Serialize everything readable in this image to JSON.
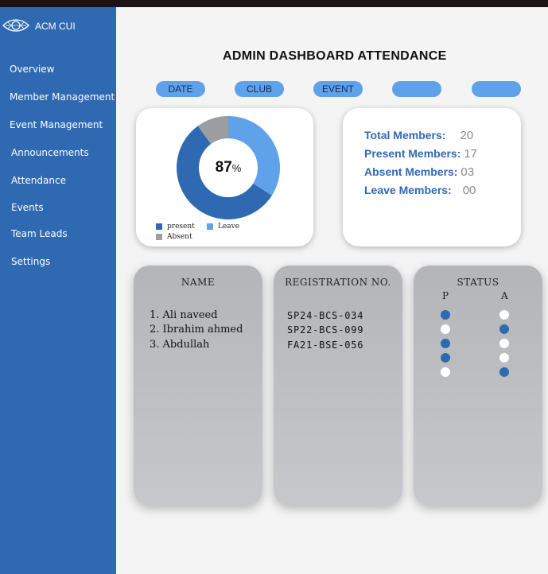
{
  "brand": {
    "name": "ACM CUI"
  },
  "nav": [
    {
      "label": "Overview"
    },
    {
      "label": "Member Management"
    },
    {
      "label": "Event Management"
    },
    {
      "label": "Announcements"
    },
    {
      "label": "Attendance"
    },
    {
      "label": "Events"
    },
    {
      "label": "Team Leads"
    },
    {
      "label": "Settings"
    }
  ],
  "page": {
    "title": "ADMIN DASHBOARD ATTENDANCE"
  },
  "filters": [
    {
      "label": "DATE"
    },
    {
      "label": "CLUB"
    },
    {
      "label": "EVENT"
    },
    {
      "label": ""
    },
    {
      "label": ""
    }
  ],
  "donut": {
    "center_value": "87",
    "center_unit": "%",
    "segments": [
      {
        "name": "present",
        "fraction": 0.56,
        "color": "#2f69b1"
      },
      {
        "name": "Leave",
        "fraction": 0.34,
        "color": "#5fa2ea"
      },
      {
        "name": "Absent",
        "fraction": 0.1,
        "color": "#9b9da1"
      }
    ],
    "legend": {
      "present": "present",
      "leave": "Leave",
      "absent": "Absent"
    }
  },
  "stats": [
    {
      "label": "Total Members:",
      "value": "20"
    },
    {
      "label": "Present Members:",
      "value": "17"
    },
    {
      "label": "Absent Members:",
      "value": "03"
    },
    {
      "label": "Leave Members:",
      "value": "00"
    }
  ],
  "table": {
    "name_header": "NAME",
    "reg_header": "REGISTRATION NO.",
    "status_header": "STATUS",
    "p_header": "P",
    "a_header": "A",
    "names": [
      "1. Ali naveed",
      "2. Ibrahim ahmed",
      "3. Abdullah"
    ],
    "regs": [
      "SP24-BCS-034",
      "SP22-BCS-099",
      "FA21-BSE-056"
    ],
    "status": [
      {
        "p": true,
        "a": false
      },
      {
        "p": false,
        "a": true
      },
      {
        "p": true,
        "a": false
      },
      {
        "p": true,
        "a": false
      },
      {
        "p": false,
        "a": true
      }
    ]
  },
  "colors": {
    "sidebar": "#2f69b1",
    "accent": "#5fa2ea",
    "dot_on": "#2f69b1",
    "dot_off": "#ffffff"
  }
}
